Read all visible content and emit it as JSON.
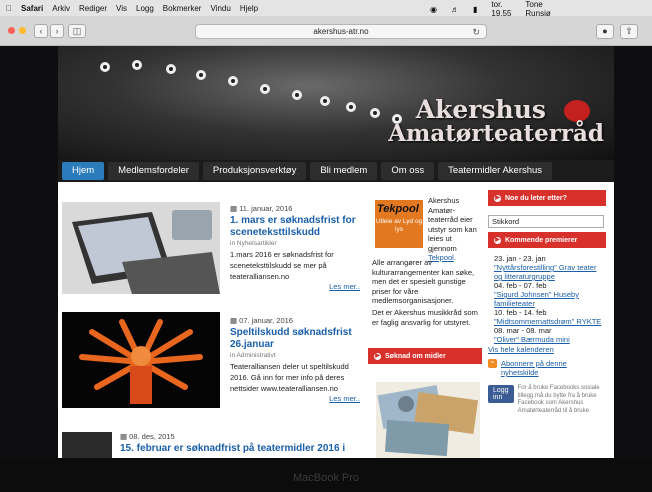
{
  "menubar": {
    "items": [
      "Safari",
      "Arkiv",
      "Rediger",
      "Vis",
      "Logg",
      "Bokmerker",
      "Vindu",
      "Hjelp"
    ],
    "clock": "tor. 19.55",
    "user": "Tone Runsjø"
  },
  "toolbar": {
    "url": "akershus-atr.no",
    "back_icon": "chevron-left-icon",
    "forward_icon": "chevron-right-icon"
  },
  "header": {
    "title_line1": "Akershus",
    "title_line2": "Amatørteaterråd"
  },
  "nav": {
    "items": [
      {
        "label": "Hjem",
        "active": true
      },
      {
        "label": "Medlemsfordeler"
      },
      {
        "label": "Produksjonsverktøy"
      },
      {
        "label": "Bli medlem"
      },
      {
        "label": "Om oss"
      },
      {
        "label": "Teatermidler Akershus"
      }
    ]
  },
  "posts": [
    {
      "date": "11. januar, 2016",
      "title": "1. mars er søknadsfrist for sceneteksttilskudd",
      "category": "Nyhetsartikler",
      "excerpt": "1.mars 2016 er søknadsfrist for sceneteksttilskudd se mer på teateralliansen.no",
      "more": "Les mer.."
    },
    {
      "date": "07. januar, 2016",
      "title": "Speltilskudd søknadsfrist 26.januar",
      "category": "Administrativt",
      "excerpt": "Teateralliansen deler ut speltilskudd 2016. Gå inn for mer info på deres nettsider www.teateralliansen.no",
      "more": "Les mer.."
    },
    {
      "date": "08. des, 2015",
      "title": "15. februar er søknadfrist på teatermidler 2016 i"
    }
  ],
  "tekpool": {
    "logo_title": "Tekpool",
    "logo_sub": "Utleie av Lyd og lys",
    "intro": "Akershus Amatør-teaterråd eier utstyr som kan leies ut gjennom",
    "link": "Tekpool",
    "p1": "Alle arrangører av kulturarrangementer kan søke, men det er spesielt gunstige priser for våre medlemsorganisasjoner.",
    "p2": "Det er Akershus musikkråd som er faglig ansvarlig for utstyret.",
    "apply_label": "Søknad om midler"
  },
  "sidebar": {
    "search_heading": "Noe du leter etter?",
    "search_value": "Stikkord",
    "premieres_heading": "Kommende premierer",
    "events": [
      {
        "dates": "23. jan - 23. jan",
        "title": "\"Nyttårsforestilling\" Grav teater og litteraturgruppe"
      },
      {
        "dates": "04. feb - 07. feb",
        "title": "\"Sigurd Johnsen\" Huseby familieteater"
      },
      {
        "dates": "10. feb - 14. feb",
        "title": "\"Midtsommernattsdrøm\" RYKTE"
      },
      {
        "dates": "08. mar - 08. mar",
        "title": "\"Oliver\" Bærmuda mini"
      }
    ],
    "calendar_link": "Vis hele kalenderen",
    "subscribe_link": "Abonnere på denne nyhetskilde",
    "login_label": "Logg inn",
    "login_text": "For å bruke Facebooks sosiale tillegg må du bytte fra å bruke Facebook som Akershus Amatørteaterråd til å bruke"
  },
  "device": {
    "brand": "MacBook Pro"
  }
}
